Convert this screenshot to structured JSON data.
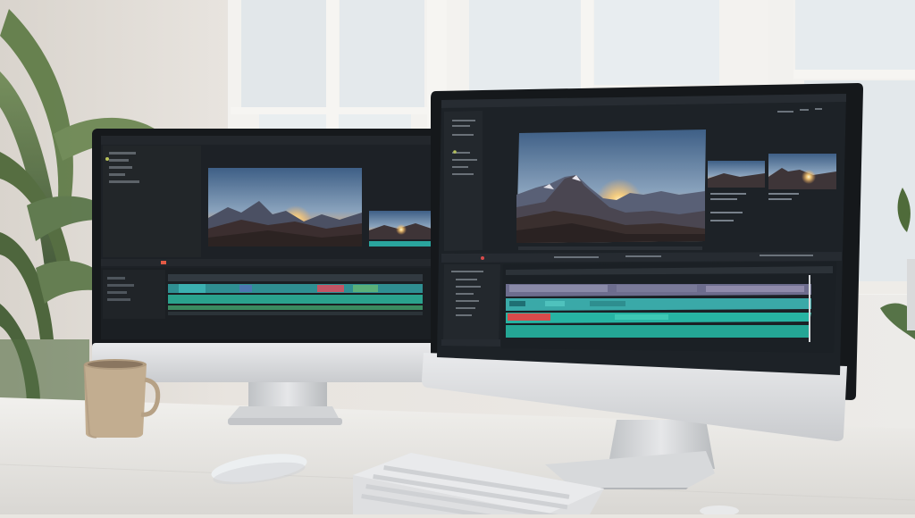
{
  "scene": {
    "description_free": true,
    "room": {
      "wall": "#e7e3dd",
      "window_frame": "#f1efeb",
      "window_glass": "#dfe6ea"
    },
    "desk": {
      "color": "#e9e7e3"
    },
    "plant": {
      "leaf_color": "#4f6b3a"
    },
    "mug": {
      "color": "#c2ad90"
    },
    "mouse": {
      "color": "#eceff1"
    },
    "keyboard": {
      "color": "#dedfe1"
    },
    "monitors": [
      {
        "id": "left",
        "app_theme": {
          "ui_bg": "#1d2126",
          "panel_bg": "#25292f",
          "track_video": "#3aa6a0",
          "track_audio": "#2fa58f",
          "accent": "#e25a45"
        },
        "preview": "mountain-sunset"
      },
      {
        "id": "right",
        "app_theme": {
          "ui_bg": "#1d2227",
          "panel_bg": "#262b31",
          "track_video": "#7f7f9a",
          "track_audio": "#27b4a3",
          "accent": "#d84b4b"
        },
        "preview": "mountain-sunset"
      }
    ]
  }
}
